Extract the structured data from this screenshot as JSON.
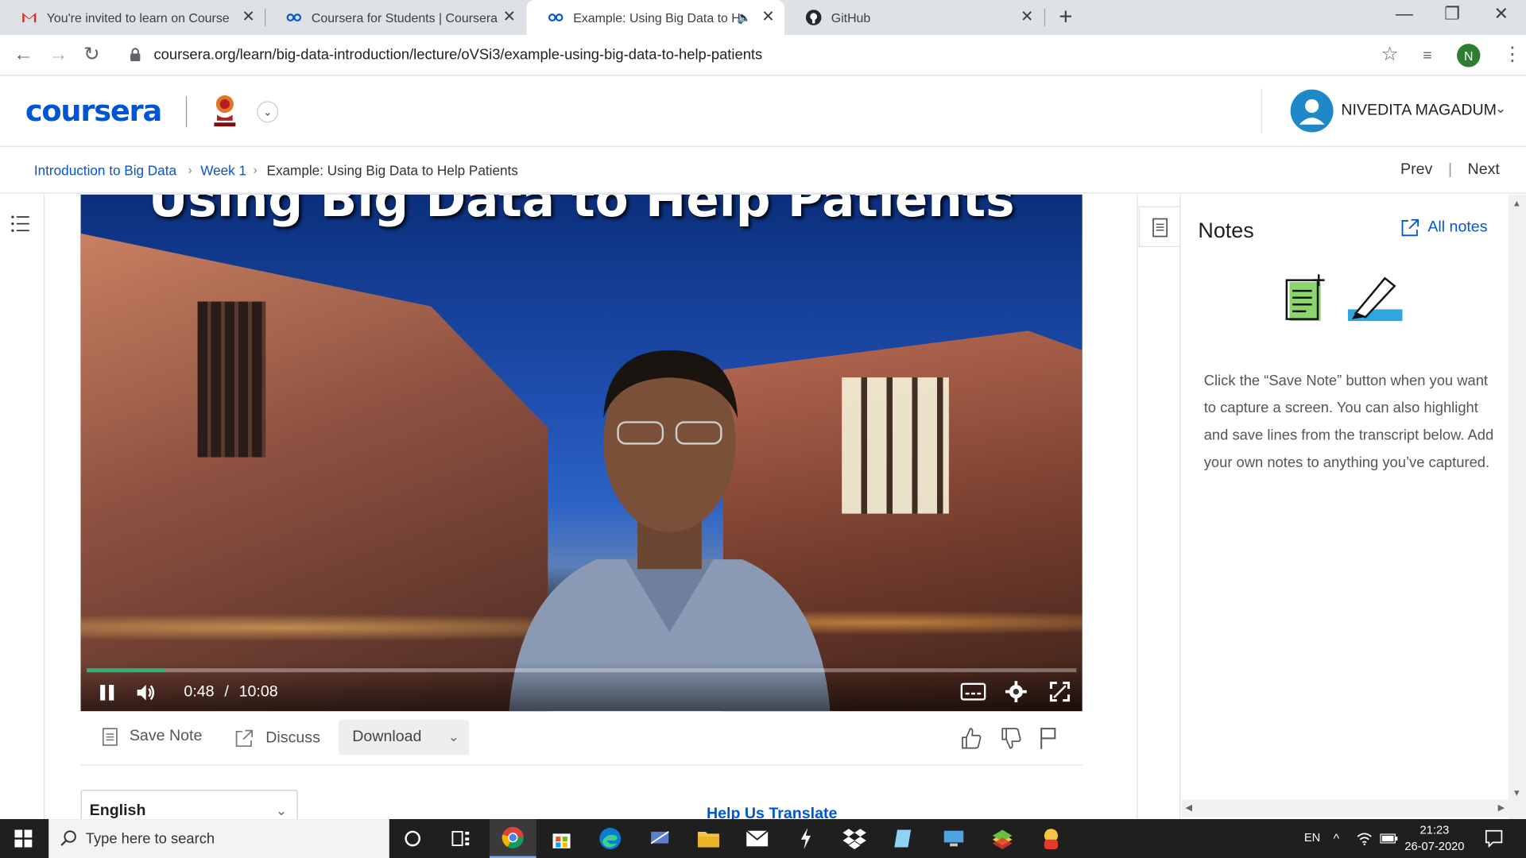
{
  "browser": {
    "tabs": [
      {
        "title": "You're invited to learn on Course",
        "icon": "gmail-icon"
      },
      {
        "title": "Coursera for Students | Coursera",
        "icon": "coursera-icon"
      },
      {
        "title": "Example: Using Big Data to H",
        "icon": "coursera-icon",
        "active": true
      },
      {
        "title": "GitHub",
        "icon": "github-icon"
      }
    ],
    "url": "coursera.org/learn/big-data-introduction/lecture/oVSi3/example-using-big-data-to-help-patients",
    "profile_initial": "N"
  },
  "header": {
    "logo": "coursera",
    "user_name": "NIVEDITA MAGADUM"
  },
  "breadcrumb": {
    "items": [
      "Introduction to Big Data",
      "Week 1",
      "Example: Using Big Data to Help Patients"
    ],
    "prev": "Prev",
    "next": "Next"
  },
  "video": {
    "title_overlay": "Using Big Data to Help Patients",
    "current_time": "0:48",
    "separator": "/",
    "duration": "10:08",
    "progress": 0.079
  },
  "actions": {
    "save_note": "Save Note",
    "discuss": "Discuss",
    "download": "Download"
  },
  "transcript": {
    "language": "English",
    "help_translate": "Help Us Translate"
  },
  "notes": {
    "title": "Notes",
    "all_notes": "All notes",
    "description": "Click the “Save Note” button when you want to capture a screen. You can also highlight and save lines from the transcript below. Add your own notes to anything you’ve captured."
  },
  "taskbar": {
    "search_placeholder": "Type here to search",
    "lang": "EN",
    "time": "21:23",
    "date": "26-07-2020"
  },
  "colors": {
    "accent": "#0056d2",
    "progress": "#2bb673",
    "taskbar": "#1f1f1f"
  }
}
